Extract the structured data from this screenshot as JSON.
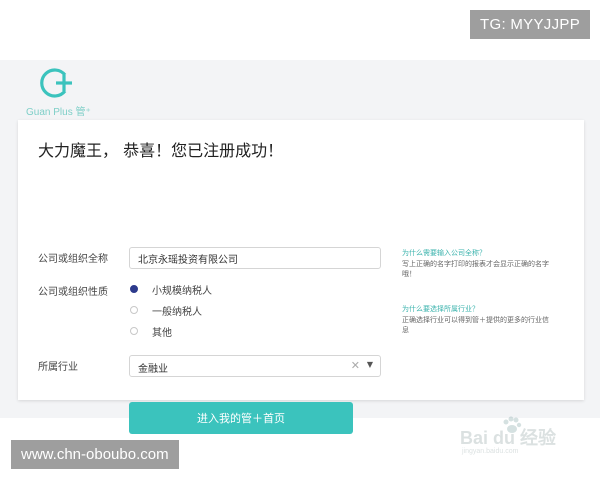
{
  "overlay": {
    "top_right_badge": "TG: MYYJJPP",
    "bottom_left_badge": "www.chn-oboubo.com"
  },
  "brand": {
    "logo_text": "Guan Plus 管⁺",
    "accent_color": "#3bc3bd"
  },
  "form": {
    "title": "大力魔王， 恭喜！您已注册成功！",
    "company": {
      "label": "公司或组织全称",
      "value": "北京永瑶投资有限公司"
    },
    "nature": {
      "label": "公司或组织性质",
      "options": [
        {
          "label": "小规模纳税人",
          "checked": true
        },
        {
          "label": "一般纳税人",
          "checked": false
        },
        {
          "label": "其他",
          "checked": false
        }
      ]
    },
    "industry": {
      "label": "所属行业",
      "value": "金融业",
      "clear_icon": "close-icon",
      "arrow_icon": "caret-down-icon"
    },
    "submit_label": "进入我的管＋首页"
  },
  "help": [
    {
      "question": "为什么需要输入公司全称？",
      "answer": "写上正确的名字打印的报表才会显示正确的名字哦！"
    },
    {
      "question": "为什么要选择所属行业？",
      "answer": "正确选择行业可以得到管＋提供的更多的行业信息"
    }
  ],
  "watermark": {
    "text": "Bai du 经验",
    "url": "jingyan.baidu.com"
  }
}
